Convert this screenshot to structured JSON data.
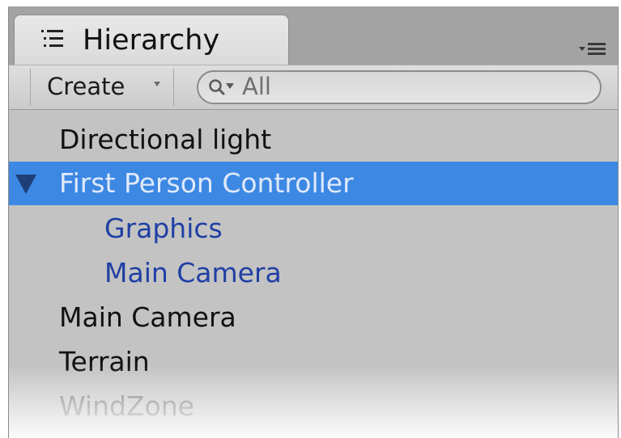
{
  "window": {
    "tab_title": "Hierarchy",
    "tab_icon": "list-icon",
    "panel_menu_icon": "panel-menu-icon"
  },
  "toolbar": {
    "create_label": "Create",
    "create_arrow_icon": "dropdown-arrow-icon",
    "search": {
      "icon": "search-filter-icon",
      "placeholder": "All",
      "value": ""
    }
  },
  "hierarchy": {
    "items": [
      {
        "label": "Directional light",
        "color": "#111111",
        "selected": false,
        "indent": 0
      },
      {
        "label": "First Person Controller",
        "color": "#dfe9fb",
        "selected": true,
        "indent": 0,
        "expanded": true
      },
      {
        "label": "Graphics",
        "color": "#1f3fa4",
        "selected": false,
        "indent": 1
      },
      {
        "label": "Main Camera",
        "color": "#1f3fa4",
        "selected": false,
        "indent": 1
      },
      {
        "label": "Main Camera",
        "color": "#111111",
        "selected": false,
        "indent": 0
      },
      {
        "label": "Terrain",
        "color": "#111111",
        "selected": false,
        "indent": 0
      },
      {
        "label": "WindZone",
        "color": "#777777",
        "selected": false,
        "indent": 0
      }
    ]
  },
  "colors": {
    "selection": "#3d88e3",
    "child_text": "#1f3fa4",
    "panel_bg": "#c3c3c3"
  }
}
